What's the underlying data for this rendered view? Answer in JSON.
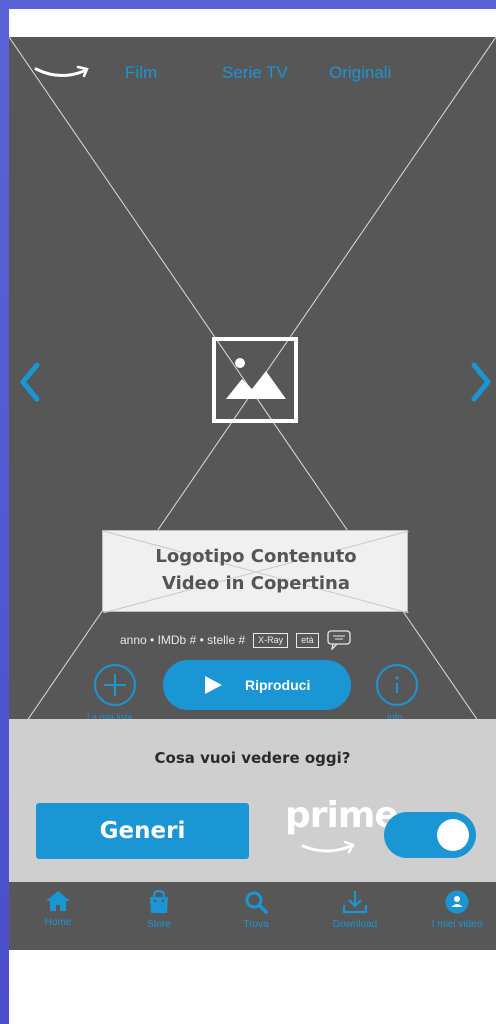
{
  "nav": {
    "items": [
      {
        "label": "Film"
      },
      {
        "label": "Serie TV"
      },
      {
        "label": "Originali"
      }
    ]
  },
  "hero": {
    "logo_placeholder": "Logotipo Contenuto\nVideo in  Copertina",
    "meta_text": "anno • IMDb # • stelle #",
    "tag_xray": "X-Ray",
    "tag_age": "età",
    "add_label": "La mia lista",
    "play_label": "Riproduci",
    "info_label": "Info"
  },
  "discover": {
    "question": "Cosa vuoi vedere oggi?",
    "genres_button": "Generi",
    "prime_word": "prime",
    "prime_toggle_on": true
  },
  "bottom_nav": {
    "items": [
      {
        "label": "Home",
        "icon": "home-icon"
      },
      {
        "label": "Store",
        "icon": "bag-icon"
      },
      {
        "label": "Trova",
        "icon": "search-icon"
      },
      {
        "label": "Download",
        "icon": "download-icon"
      },
      {
        "label": "I miei video",
        "icon": "user-icon"
      }
    ]
  },
  "colors": {
    "accent": "#1a96d4",
    "hero_bg": "#575757",
    "panel_bg": "#cfcfcf",
    "outer_bg": "#4a4ecf"
  }
}
